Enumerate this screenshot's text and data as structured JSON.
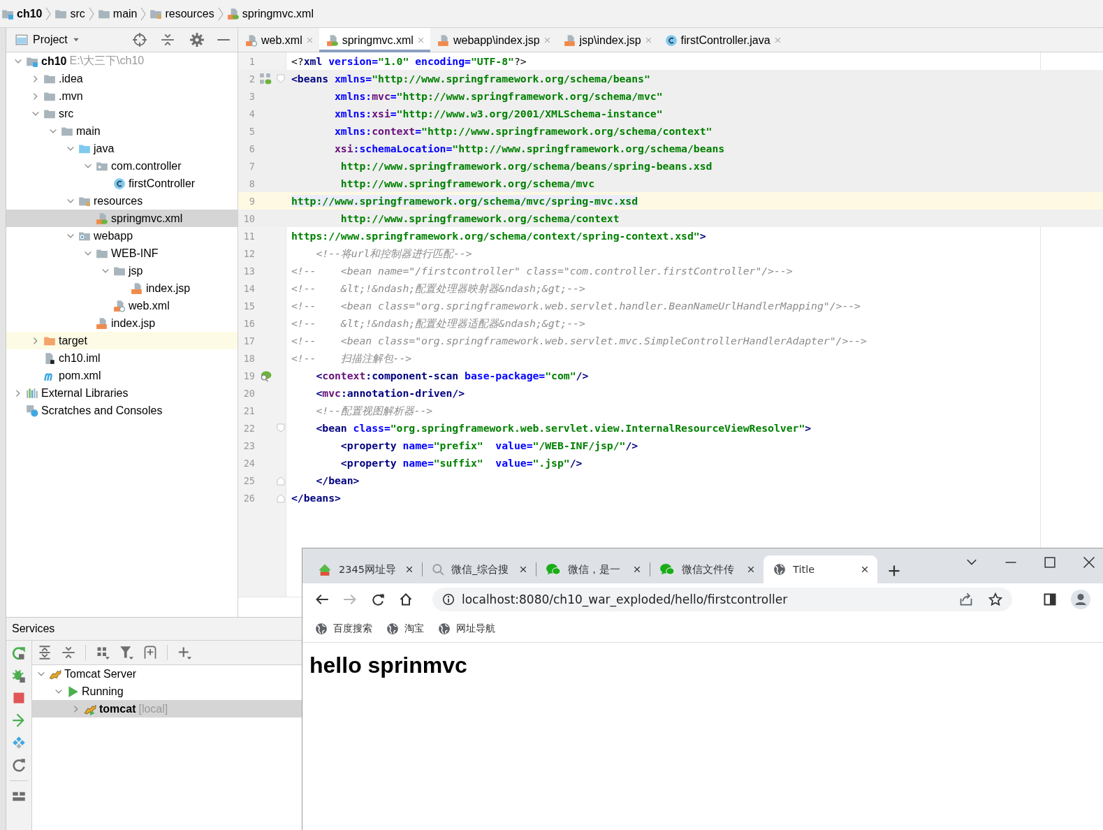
{
  "breadcrumb": [
    {
      "label": "ch10",
      "kind": "module"
    },
    {
      "label": "src",
      "kind": "folder"
    },
    {
      "label": "main",
      "kind": "folder"
    },
    {
      "label": "resources",
      "kind": "resources"
    },
    {
      "label": "springmvc.xml",
      "kind": "spring-xml"
    }
  ],
  "project_panel": {
    "title": "Project",
    "tree": [
      {
        "label": "ch10",
        "detail": "E:\\大三下\\ch10",
        "kind": "module",
        "expanded": true,
        "selected": false,
        "children": [
          {
            "label": ".idea",
            "kind": "folder",
            "expanded": false,
            "selected": false
          },
          {
            "label": ".mvn",
            "kind": "folder",
            "expanded": false,
            "selected": false
          },
          {
            "label": "src",
            "kind": "folder",
            "expanded": true,
            "selected": false,
            "children": [
              {
                "label": "main",
                "kind": "folder",
                "expanded": true,
                "selected": false,
                "children": [
                  {
                    "label": "java",
                    "kind": "source",
                    "expanded": true,
                    "selected": false,
                    "children": [
                      {
                        "label": "com.controller",
                        "kind": "package",
                        "expanded": true,
                        "selected": false,
                        "children": [
                          {
                            "label": "firstController",
                            "kind": "class",
                            "selected": false
                          }
                        ]
                      }
                    ]
                  },
                  {
                    "label": "resources",
                    "kind": "resources",
                    "expanded": true,
                    "selected": false,
                    "children": [
                      {
                        "label": "springmvc.xml",
                        "kind": "spring-xml",
                        "selected": true
                      }
                    ]
                  },
                  {
                    "label": "webapp",
                    "kind": "web",
                    "expanded": true,
                    "selected": false,
                    "children": [
                      {
                        "label": "WEB-INF",
                        "kind": "folder",
                        "expanded": true,
                        "selected": false,
                        "children": [
                          {
                            "label": "jsp",
                            "kind": "folder",
                            "expanded": true,
                            "selected": false,
                            "children": [
                              {
                                "label": "index.jsp",
                                "kind": "jsp",
                                "selected": false
                              }
                            ]
                          },
                          {
                            "label": "web.xml",
                            "kind": "web-xml",
                            "selected": false
                          }
                        ]
                      },
                      {
                        "label": "index.jsp",
                        "kind": "jsp",
                        "selected": false
                      }
                    ]
                  }
                ]
              }
            ]
          },
          {
            "label": "target",
            "kind": "excluded",
            "expanded": false,
            "selected": false,
            "highlighted": true
          },
          {
            "label": "ch10.iml",
            "kind": "iml",
            "selected": false
          },
          {
            "label": "pom.xml",
            "kind": "maven",
            "selected": false
          }
        ]
      },
      {
        "label": "External Libraries",
        "kind": "libraries",
        "expanded": false,
        "selected": false
      },
      {
        "label": "Scratches and Consoles",
        "kind": "scratches",
        "selected": false
      }
    ]
  },
  "editor": {
    "tabs": [
      {
        "label": "web.xml",
        "kind": "web-xml",
        "selected": false
      },
      {
        "label": "springmvc.xml",
        "kind": "spring-xml",
        "selected": true
      },
      {
        "label": "webapp\\index.jsp",
        "kind": "jsp",
        "selected": false
      },
      {
        "label": "jsp\\index.jsp",
        "kind": "jsp",
        "selected": false
      },
      {
        "label": "firstController.java",
        "kind": "class",
        "selected": false
      }
    ],
    "lines": [
      {
        "number": "1",
        "current": false,
        "shaded": false,
        "segments": [
          {
            "kind": "text",
            "text": "<?"
          },
          {
            "kind": "tag",
            "text": "xml"
          },
          {
            "kind": "attr",
            "text": " version="
          },
          {
            "kind": "value",
            "text": "\"1.0\""
          },
          {
            "kind": "attr",
            "text": " encoding="
          },
          {
            "kind": "value",
            "text": "\"UTF-8\""
          },
          {
            "kind": "text",
            "text": "?>"
          }
        ]
      },
      {
        "number": "2",
        "current": false,
        "shaded": true,
        "segments": [
          {
            "kind": "tag",
            "text": "<beans"
          },
          {
            "kind": "attr",
            "text": " xmlns="
          },
          {
            "kind": "value",
            "text": "\"http://www.springframework.org/schema/beans\""
          }
        ]
      },
      {
        "number": "3",
        "current": false,
        "shaded": true,
        "segments": [
          {
            "kind": "attr",
            "text": "       xmlns:"
          },
          {
            "kind": "ns",
            "text": "mvc"
          },
          {
            "kind": "attr",
            "text": "="
          },
          {
            "kind": "value",
            "text": "\"http://www.springframework.org/schema/mvc\""
          }
        ]
      },
      {
        "number": "4",
        "current": false,
        "shaded": true,
        "segments": [
          {
            "kind": "attr",
            "text": "       xmlns:"
          },
          {
            "kind": "ns",
            "text": "xsi"
          },
          {
            "kind": "attr",
            "text": "="
          },
          {
            "kind": "value",
            "text": "\"http://www.w3.org/2001/XMLSchema-instance\""
          }
        ]
      },
      {
        "number": "5",
        "current": false,
        "shaded": true,
        "segments": [
          {
            "kind": "attr",
            "text": "       xmlns:"
          },
          {
            "kind": "ns",
            "text": "context"
          },
          {
            "kind": "attr",
            "text": "="
          },
          {
            "kind": "value",
            "text": "\"http://www.springframework.org/schema/context\""
          }
        ]
      },
      {
        "number": "6",
        "current": false,
        "shaded": true,
        "segments": [
          {
            "kind": "ns",
            "text": "       xsi"
          },
          {
            "kind": "attr",
            "text": ":schemaLocation="
          },
          {
            "kind": "value",
            "text": "\"http://www.springframework.org/schema/beans"
          }
        ]
      },
      {
        "number": "7",
        "current": false,
        "shaded": true,
        "segments": [
          {
            "kind": "value",
            "text": "        http://www.springframework.org/schema/beans/spring-beans.xsd"
          }
        ]
      },
      {
        "number": "8",
        "current": false,
        "shaded": true,
        "segments": [
          {
            "kind": "value",
            "text": "        http://www.springframework.org/schema/mvc"
          }
        ]
      },
      {
        "number": "9",
        "current": true,
        "shaded": true,
        "segments": [
          {
            "kind": "value",
            "text": "http://www.springframework.org/schema/mvc/spring-mvc.xsd"
          }
        ]
      },
      {
        "number": "10",
        "current": false,
        "shaded": true,
        "segments": [
          {
            "kind": "value",
            "text": "        http://www.springframework.org/schema/context"
          }
        ]
      },
      {
        "number": "11",
        "current": false,
        "shaded": false,
        "segments": [
          {
            "kind": "value",
            "text": "https://www.springframework.org/schema/context/spring-context.xsd\""
          },
          {
            "kind": "tag",
            "text": ">"
          }
        ]
      },
      {
        "number": "12",
        "current": false,
        "shaded": false,
        "segments": [
          {
            "kind": "comment",
            "text": "    <!--将url和控制器进行匹配-->"
          }
        ]
      },
      {
        "number": "13",
        "current": false,
        "shaded": false,
        "segments": [
          {
            "kind": "comment",
            "text": "<!--    <bean name=\"/firstcontroller\" class=\"com.controller.firstController\"/>-->"
          }
        ]
      },
      {
        "number": "14",
        "current": false,
        "shaded": false,
        "segments": [
          {
            "kind": "comment",
            "text": "<!--    &lt;!&ndash;配置处理器映射器&ndash;&gt;-->"
          }
        ]
      },
      {
        "number": "15",
        "current": false,
        "shaded": false,
        "segments": [
          {
            "kind": "comment",
            "text": "<!--    <bean class=\"org.springframework.web.servlet.handler.BeanNameUrlHandlerMapping\"/>-->"
          }
        ]
      },
      {
        "number": "16",
        "current": false,
        "shaded": false,
        "segments": [
          {
            "kind": "comment",
            "text": "<!--    &lt;!&ndash;配置处理器适配器&ndash;&gt;-->"
          }
        ]
      },
      {
        "number": "17",
        "current": false,
        "shaded": false,
        "segments": [
          {
            "kind": "comment",
            "text": "<!--    <bean class=\"org.springframework.web.servlet.mvc.SimpleControllerHandlerAdapter\"/>-->"
          }
        ]
      },
      {
        "number": "18",
        "current": false,
        "shaded": false,
        "segments": [
          {
            "kind": "comment",
            "text": "<!--    扫描注解包-->"
          }
        ]
      },
      {
        "number": "19",
        "current": false,
        "shaded": false,
        "segments": [
          {
            "kind": "tag",
            "text": "    <"
          },
          {
            "kind": "ns",
            "text": "context"
          },
          {
            "kind": "tag",
            "text": ":component-scan"
          },
          {
            "kind": "attr",
            "text": " base-package="
          },
          {
            "kind": "value",
            "text": "\"com\""
          },
          {
            "kind": "tag",
            "text": "/>"
          }
        ]
      },
      {
        "number": "20",
        "current": false,
        "shaded": false,
        "segments": [
          {
            "kind": "tag",
            "text": "    <"
          },
          {
            "kind": "ns",
            "text": "mvc"
          },
          {
            "kind": "tag",
            "text": ":annotation-driven/>"
          }
        ]
      },
      {
        "number": "21",
        "current": false,
        "shaded": false,
        "segments": [
          {
            "kind": "comment",
            "text": "    <!--配置视图解析器-->"
          }
        ]
      },
      {
        "number": "22",
        "current": false,
        "shaded": false,
        "segments": [
          {
            "kind": "tag",
            "text": "    <bean"
          },
          {
            "kind": "attr",
            "text": " class="
          },
          {
            "kind": "value",
            "text": "\"org.springframework.web.servlet.view.InternalResourceViewResolver\""
          },
          {
            "kind": "tag",
            "text": ">"
          }
        ]
      },
      {
        "number": "23",
        "current": false,
        "shaded": false,
        "segments": [
          {
            "kind": "tag",
            "text": "        <property"
          },
          {
            "kind": "attr",
            "text": " name="
          },
          {
            "kind": "value",
            "text": "\"prefix\""
          },
          {
            "kind": "attr",
            "text": "  value="
          },
          {
            "kind": "value",
            "text": "\"/WEB-INF/jsp/\""
          },
          {
            "kind": "tag",
            "text": "/>"
          }
        ]
      },
      {
        "number": "24",
        "current": false,
        "shaded": false,
        "segments": [
          {
            "kind": "tag",
            "text": "        <property"
          },
          {
            "kind": "attr",
            "text": " name="
          },
          {
            "kind": "value",
            "text": "\"suffix\""
          },
          {
            "kind": "attr",
            "text": "  value="
          },
          {
            "kind": "value",
            "text": "\".jsp\""
          },
          {
            "kind": "tag",
            "text": "/>"
          }
        ]
      },
      {
        "number": "25",
        "current": false,
        "shaded": false,
        "segments": [
          {
            "kind": "tag",
            "text": "    </bean>"
          }
        ]
      },
      {
        "number": "26",
        "current": false,
        "shaded": false,
        "segments": [
          {
            "kind": "tag",
            "text": "</beans>"
          }
        ]
      }
    ]
  },
  "services": {
    "title": "Services",
    "tree": [
      {
        "label": "Tomcat Server",
        "kind": "server",
        "expanded": true,
        "selected": false,
        "children": [
          {
            "label": "Running",
            "kind": "status",
            "expanded": true,
            "selected": false,
            "children": [
              {
                "label": "tomcat",
                "detail": "[local]",
                "kind": "instance",
                "expanded": false,
                "selected": true
              }
            ]
          }
        ]
      }
    ]
  },
  "browser": {
    "tabs": [
      {
        "title": "2345网址导",
        "kind": "home",
        "selected": false
      },
      {
        "title": "微信_综合搜",
        "kind": "search",
        "selected": false
      },
      {
        "title": "微信，是一",
        "kind": "chat",
        "selected": false
      },
      {
        "title": "微信文件传",
        "kind": "chat",
        "selected": false
      },
      {
        "title": "Title",
        "kind": "globe",
        "selected": true
      }
    ],
    "back_disabled": false,
    "forward_disabled": true,
    "url": "localhost:8080/ch10_war_exploded/hello/firstcontroller",
    "bookmarks": [
      {
        "label": "百度搜索"
      },
      {
        "label": "淘宝"
      },
      {
        "label": "网址导航"
      }
    ],
    "heading": "hello sprinmvc"
  }
}
